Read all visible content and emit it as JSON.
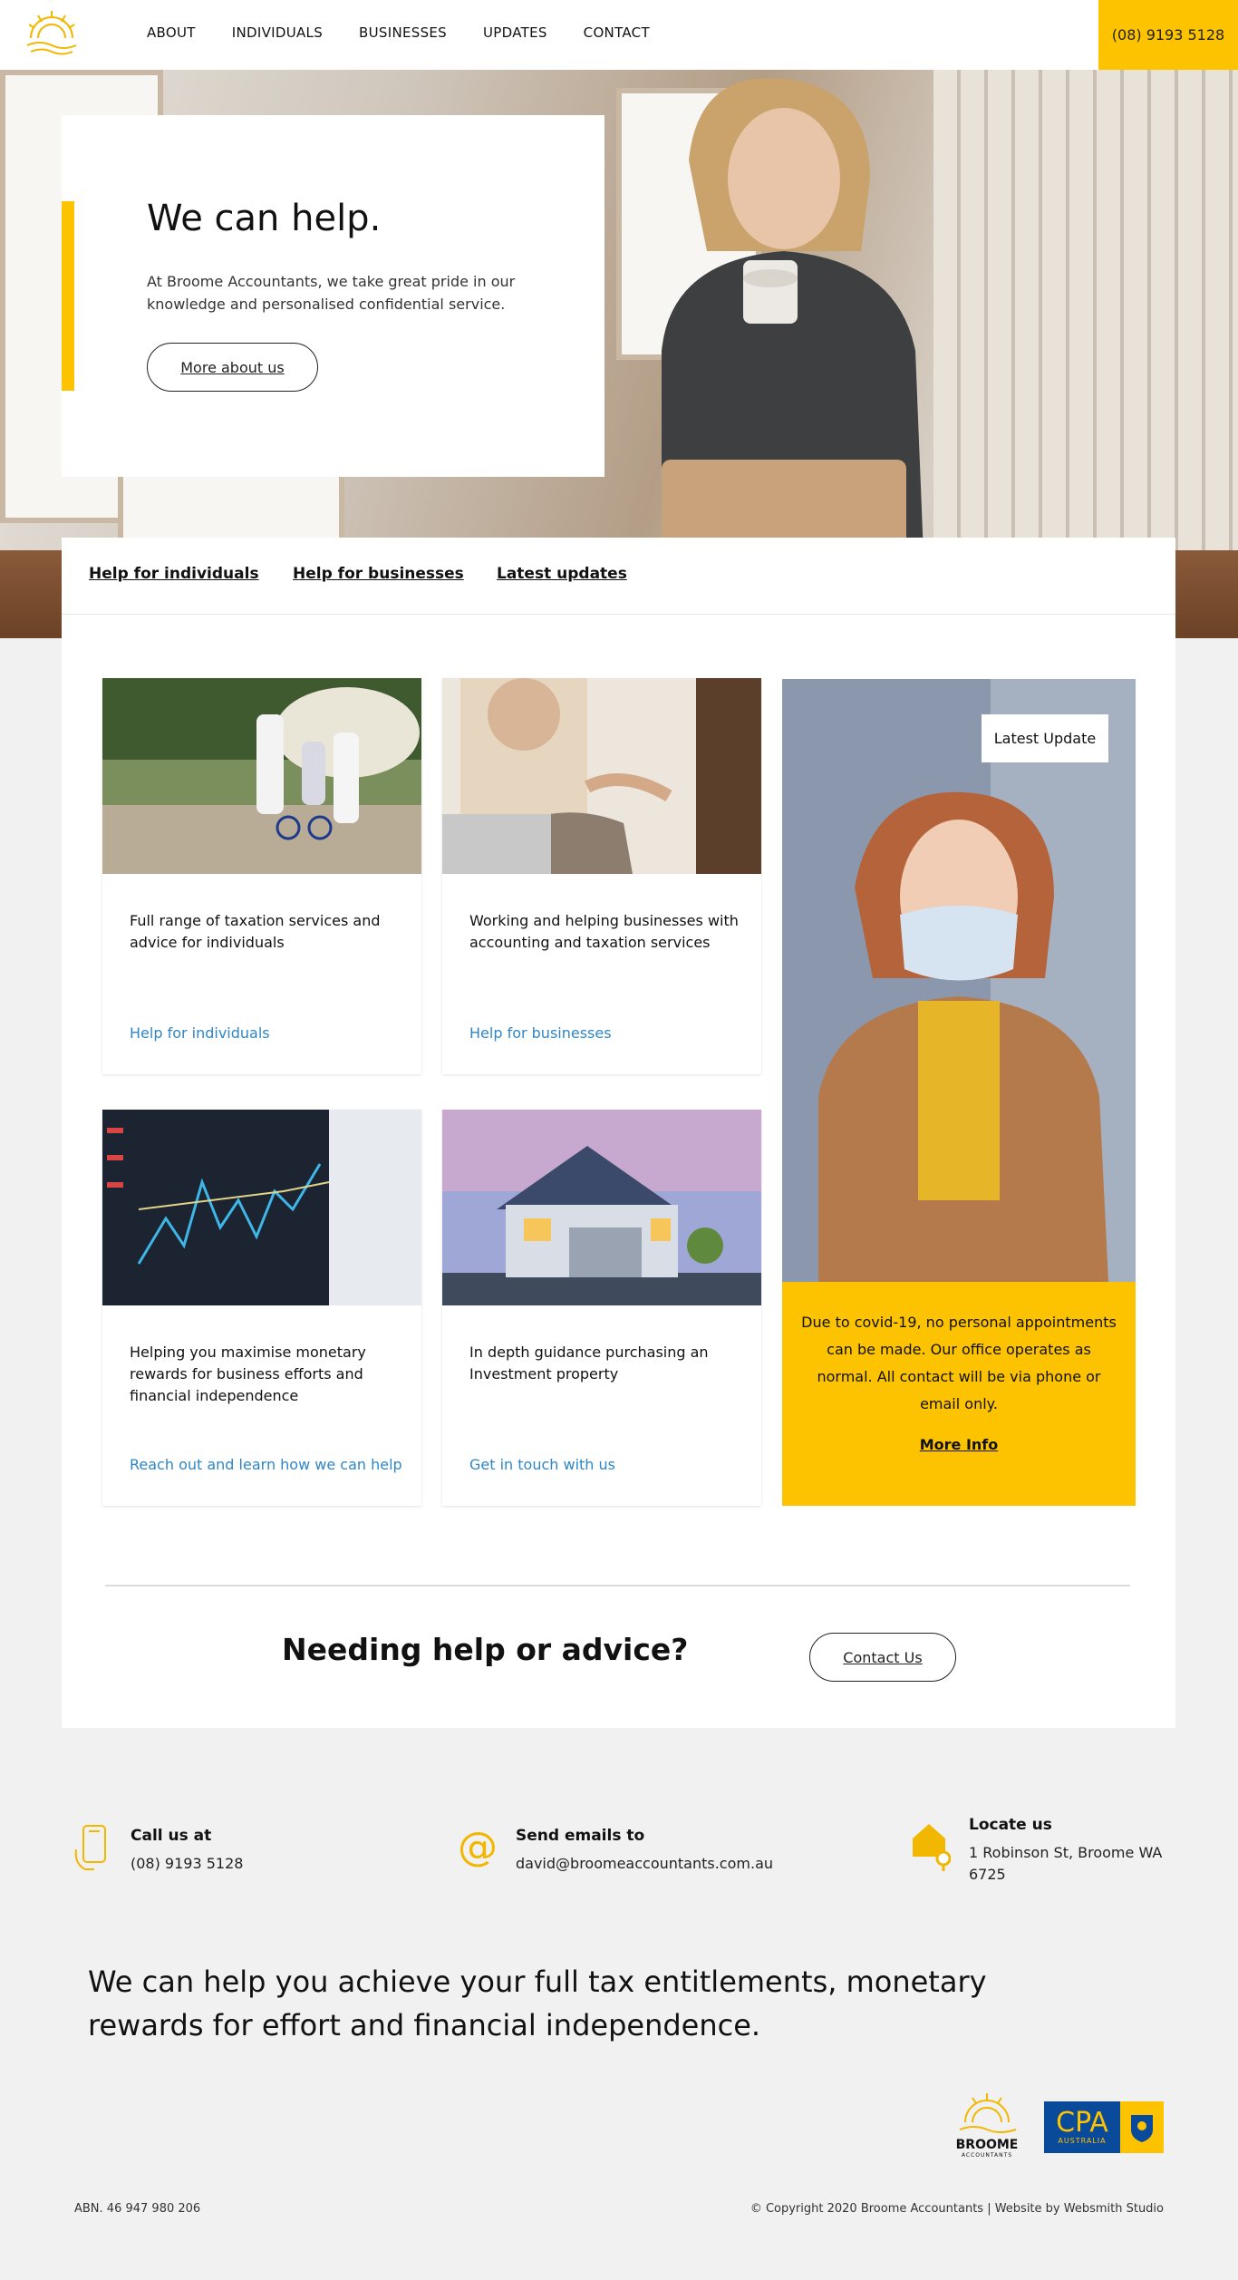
{
  "header": {
    "nav": [
      "ABOUT",
      "INDIVIDUALS",
      "BUSINESSES",
      "UPDATES",
      "CONTACT"
    ],
    "phone": "(08) 9193 5128"
  },
  "hero": {
    "title": "We can help.",
    "text": "At Broome Accountants, we take great pride in our knowledge and personalised confidential service.",
    "button": "More about us"
  },
  "tabs": [
    "Help for individuals",
    "Help for businesses",
    "Latest updates"
  ],
  "cards": [
    {
      "desc": "Full range of taxation services and advice for individuals",
      "link": "Help for individuals"
    },
    {
      "desc": "Working and helping businesses with accounting and taxation services",
      "link": "Help for businesses"
    },
    {
      "desc": "Helping you maximise monetary rewards for business efforts and financial independence",
      "link": "Reach out and learn how we can help"
    },
    {
      "desc": "In depth guidance purchasing an Investment property",
      "link": "Get in touch with us"
    }
  ],
  "update": {
    "tag": "Latest Update",
    "text": "Due to covid-19, no personal appointments can be made. Our office operates as normal. All contact will be via phone or email only.",
    "more": "More Info"
  },
  "cta": {
    "heading": "Needing help or advice?",
    "button": "Contact Us"
  },
  "contact": {
    "call_label": "Call us at",
    "call_value": "(08) 9193 5128",
    "email_label": "Send emails to",
    "email_value": "david@broomeaccountants.com.au",
    "locate_label": "Locate us",
    "locate_value": "1 Robinson St, Broome WA 6725"
  },
  "tagline": "We can help you achieve your full tax entitlements, monetary rewards for effort and financial independence.",
  "footer": {
    "logo_name": "BROOME",
    "logo_sub": "ACCOUNTANTS",
    "cpa": "CPA",
    "cpa_sub": "AUSTRALIA",
    "abn": "ABN. 46 947 980 206",
    "copyright": "© Copyright 2020 Broome Accountants | Website by Websmith Studio"
  },
  "colors": {
    "accent": "#fdc300",
    "link": "#2f86c6",
    "cpa_blue": "#0a4a9b"
  }
}
